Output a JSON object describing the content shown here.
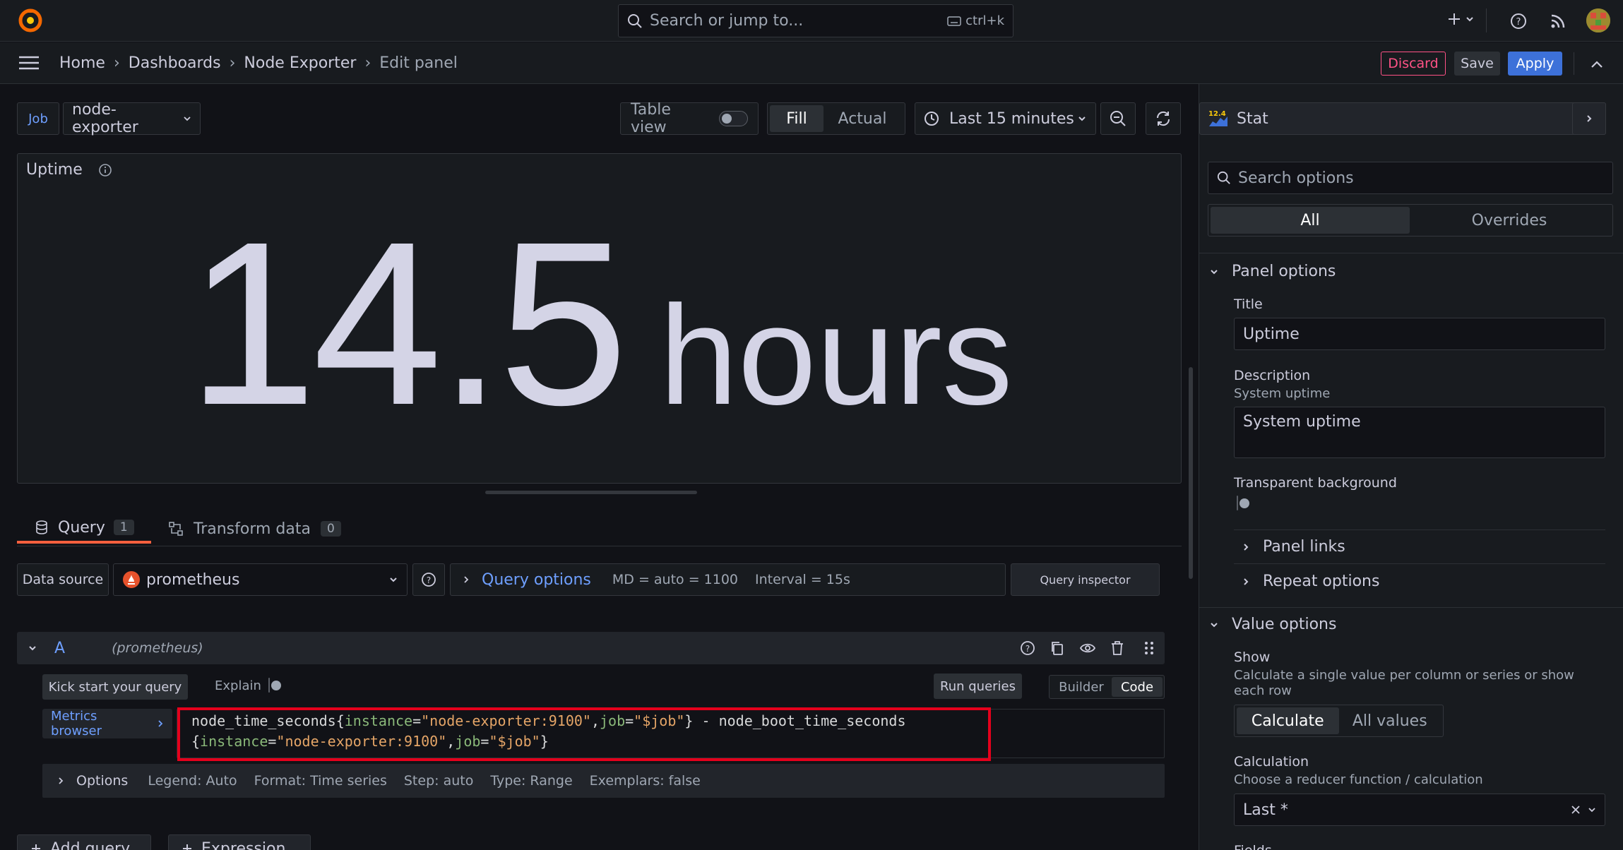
{
  "topbar": {
    "search_placeholder": "Search or jump to...",
    "search_shortcut": "ctrl+k"
  },
  "breadcrumb": [
    "Home",
    "Dashboards",
    "Node Exporter",
    "Edit panel"
  ],
  "actions": {
    "discard": "Discard",
    "save": "Save",
    "apply": "Apply"
  },
  "toolbar": {
    "job_label": "Job",
    "job_value": "node-exporter",
    "table_view": "Table view",
    "fill": "Fill",
    "actual": "Actual",
    "time_range": "Last 15 minutes"
  },
  "panel": {
    "title": "Uptime",
    "value": "14.5",
    "unit": "hours"
  },
  "tabs": {
    "query": "Query",
    "query_count": "1",
    "transform": "Transform data",
    "transform_count": "0"
  },
  "datasource": {
    "label": "Data source",
    "value": "prometheus",
    "query_options": "Query options",
    "md": "MD = auto = 1100",
    "interval": "Interval = 15s",
    "inspector": "Query inspector"
  },
  "query": {
    "ref": "A",
    "ds": "(prometheus)",
    "kick_start": "Kick start your query",
    "explain": "Explain",
    "run": "Run queries",
    "builder": "Builder",
    "code": "Code",
    "metrics_browser": "Metrics browser",
    "line1": {
      "metric": "node_time_seconds{",
      "k1": "instance",
      "v1": "\"node-exporter:9100\"",
      "k2": "job",
      "v2": "\"$job\"",
      "rest": "} - node_boot_time_seconds"
    },
    "line2": {
      "k1": "instance",
      "v1": "\"node-exporter:9100\"",
      "k2": "job",
      "v2": "\"$job\""
    },
    "options_label": "Options",
    "legend": "Legend: Auto",
    "format": "Format: Time series",
    "step": "Step: auto",
    "type": "Type: Range",
    "exemplars": "Exemplars: false",
    "add_query": "Add query",
    "expression": "Expression"
  },
  "sidebar": {
    "viz": "Stat",
    "viz_badge": "12.4",
    "search_placeholder": "Search options",
    "tab_all": "All",
    "tab_overrides": "Overrides",
    "panel_options": "Panel options",
    "title_label": "Title",
    "title_value": "Uptime",
    "desc_label": "Description",
    "desc_sub": "System uptime",
    "desc_value": "System uptime",
    "transparent": "Transparent background",
    "panel_links": "Panel links",
    "repeat_options": "Repeat options",
    "value_options": "Value options",
    "show_label": "Show",
    "show_sub": "Calculate a single value per column or series or show each row",
    "calculate": "Calculate",
    "all_values": "All values",
    "calc_label": "Calculation",
    "calc_sub": "Choose a reducer function / calculation",
    "calc_value": "Last *",
    "fields_label": "Fields"
  },
  "colors": {
    "accent": "#3d71d9",
    "discard": "#ff5286",
    "highlight": "#e5001c",
    "orange": "#f55f3e"
  }
}
